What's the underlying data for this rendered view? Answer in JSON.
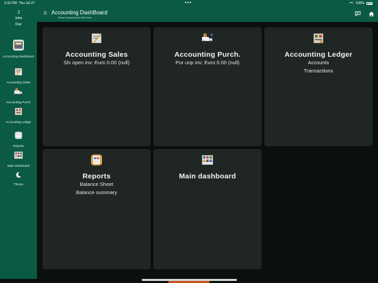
{
  "status_bar": {
    "time": "2:32 PM",
    "date": "Thu Jul 27",
    "dots": "•••",
    "battery": "100%"
  },
  "header": {
    "initial": "D",
    "title": "Accounting DashBoard",
    "subtitle": "Demo company from John Doe"
  },
  "sidebar": {
    "user_initial": "J",
    "user_first": "John",
    "user_last": "Doe",
    "items": [
      {
        "label": "Accounting Dashboard",
        "icon": "accounting-dashboard-icon"
      },
      {
        "label": "Accounting Sales",
        "icon": "accounting-sales-icon"
      },
      {
        "label": "Accounting Purch.",
        "icon": "accounting-purch-icon"
      },
      {
        "label": "Accounting Ledger",
        "icon": "accounting-ledger-icon"
      },
      {
        "label": "Reports",
        "icon": "reports-icon"
      },
      {
        "label": "Main dashboard",
        "icon": "main-dashboard-icon"
      },
      {
        "label": "Theme",
        "icon": "moon-icon"
      }
    ]
  },
  "tiles": [
    {
      "title": "Accounting Sales",
      "lines": [
        "Sls open inv: Euro 0.00 (null)"
      ]
    },
    {
      "title": "Accounting Purch.",
      "lines": [
        "Pur unp inv: Euro 0.00 (null)"
      ]
    },
    {
      "title": "Accounting Ledger",
      "lines": [
        "Accounts",
        "Transactions"
      ]
    },
    {
      "title": "Reports",
      "lines": [
        "Balance Sheet",
        "Balance summary"
      ]
    },
    {
      "title": "Main dashboard",
      "lines": []
    }
  ],
  "colors": {
    "brand": "#0a5a44",
    "tile_bg": "#1f2624",
    "page_bg": "#0b100f"
  }
}
